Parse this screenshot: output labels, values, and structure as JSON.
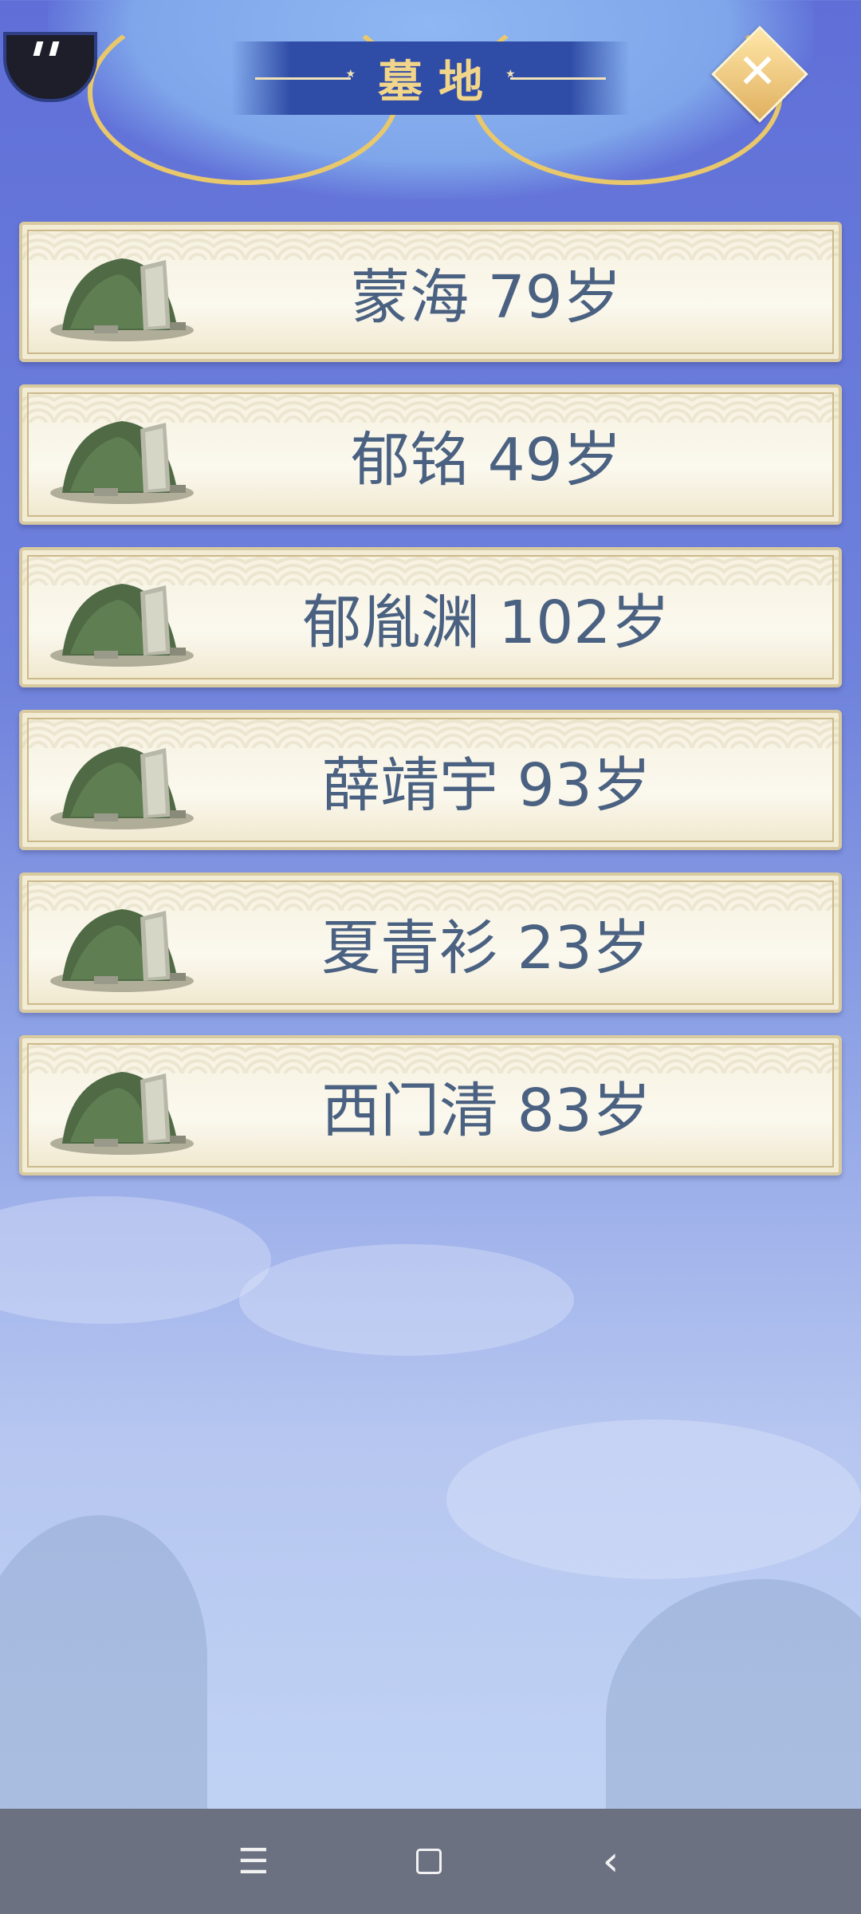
{
  "header": {
    "title": "墓地",
    "close_icon": "close-icon",
    "avatar_icon": "avatar-icon"
  },
  "graves": [
    {
      "label": "蒙海 79岁"
    },
    {
      "label": "郁铭 49岁"
    },
    {
      "label": "郁胤渊 102岁"
    },
    {
      "label": "薛靖宇 93岁"
    },
    {
      "label": "夏青衫 23岁"
    },
    {
      "label": "西门清 83岁"
    }
  ],
  "navbar": {
    "menu_glyph": "☰",
    "back_glyph": "‹"
  },
  "colors": {
    "text": "#4a6181",
    "title": "#f1d58a",
    "panel": "#f6f1df",
    "background": "#6f82dc"
  }
}
